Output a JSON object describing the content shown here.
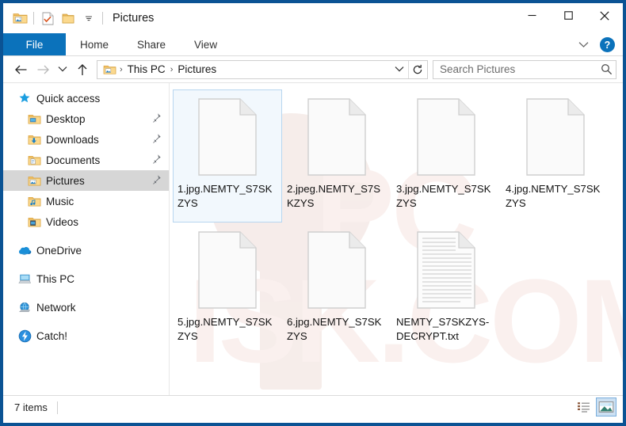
{
  "window": {
    "title": "Pictures",
    "frame_color": "#0b5394",
    "accent_color": "#0b72bb"
  },
  "quick_access_toolbar": {
    "items": [
      {
        "name": "pictures-folder-icon",
        "tooltip": "Pictures"
      },
      {
        "name": "properties-icon",
        "tooltip": "Properties"
      },
      {
        "name": "new-folder-icon",
        "tooltip": "New folder"
      },
      {
        "name": "customize-chevron-icon",
        "tooltip": "Customize Quick Access Toolbar"
      }
    ]
  },
  "caption_buttons": {
    "minimize": "—",
    "maximize": "☐",
    "close": "✕"
  },
  "ribbon": {
    "file_tab": "File",
    "tabs": [
      {
        "label": "Home"
      },
      {
        "label": "Share"
      },
      {
        "label": "View"
      }
    ],
    "expand_label": "⌄",
    "help_label": "?"
  },
  "address_bar": {
    "back_icon": "←",
    "forward_icon": "→",
    "recent_icon": "⌄",
    "up_icon": "↑",
    "breadcrumb": [
      {
        "label": "This PC"
      },
      {
        "label": "Pictures"
      }
    ],
    "breadcrumb_separator": "›",
    "dropdown_icon": "⌄",
    "refresh_icon": "↻"
  },
  "search": {
    "placeholder": "Search Pictures",
    "value": "",
    "icon": "search-icon"
  },
  "navigation_pane": {
    "groups": [
      {
        "header": {
          "label": "Quick access",
          "icon": "star-icon"
        },
        "items": [
          {
            "label": "Desktop",
            "icon": "desktop-folder-icon",
            "pinned": true,
            "selected": false
          },
          {
            "label": "Downloads",
            "icon": "downloads-folder-icon",
            "pinned": true,
            "selected": false
          },
          {
            "label": "Documents",
            "icon": "documents-folder-icon",
            "pinned": true,
            "selected": false
          },
          {
            "label": "Pictures",
            "icon": "pictures-folder-icon",
            "pinned": true,
            "selected": true
          },
          {
            "label": "Music",
            "icon": "music-folder-icon",
            "pinned": false,
            "selected": false
          },
          {
            "label": "Videos",
            "icon": "videos-folder-icon",
            "pinned": false,
            "selected": false
          }
        ]
      },
      {
        "items": [
          {
            "label": "OneDrive",
            "icon": "onedrive-cloud-icon",
            "pinned": false,
            "selected": false
          }
        ]
      },
      {
        "items": [
          {
            "label": "This PC",
            "icon": "this-pc-icon",
            "pinned": false,
            "selected": false
          }
        ]
      },
      {
        "items": [
          {
            "label": "Network",
            "icon": "network-icon",
            "pinned": false,
            "selected": false
          }
        ]
      },
      {
        "items": [
          {
            "label": "Catch!",
            "icon": "catch-lightning-icon",
            "pinned": false,
            "selected": false
          }
        ]
      }
    ]
  },
  "files": [
    {
      "name": "1.jpg.NEMTY_S7SKZYS",
      "icon": "blank-file-icon",
      "selected": true
    },
    {
      "name": "2.jpeg.NEMTY_S7SKZYS",
      "icon": "blank-file-icon",
      "selected": false
    },
    {
      "name": "3.jpg.NEMTY_S7SKZYS",
      "icon": "blank-file-icon",
      "selected": false
    },
    {
      "name": "4.jpg.NEMTY_S7SKZYS",
      "icon": "blank-file-icon",
      "selected": false
    },
    {
      "name": "5.jpg.NEMTY_S7SKZYS",
      "icon": "blank-file-icon",
      "selected": false
    },
    {
      "name": "6.jpg.NEMTY_S7SKZYS",
      "icon": "blank-file-icon",
      "selected": false
    },
    {
      "name": "NEMTY_S7SKZYS-DECRYPT.txt",
      "icon": "text-file-icon",
      "selected": false
    }
  ],
  "status_bar": {
    "item_count_text": "7 items",
    "view_buttons": [
      {
        "name": "details-view-button",
        "active": false
      },
      {
        "name": "large-icons-view-button",
        "active": true
      }
    ]
  },
  "watermark": {
    "text": "PCRISK.COM"
  }
}
